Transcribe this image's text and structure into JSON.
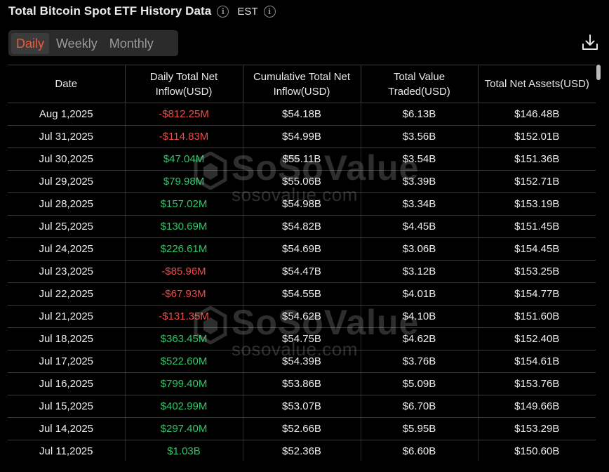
{
  "header": {
    "title": "Total Bitcoin Spot ETF History Data",
    "timezone": "EST",
    "info_icon": "info-icon"
  },
  "tabs": [
    {
      "label": "Daily",
      "active": true
    },
    {
      "label": "Weekly",
      "active": false
    },
    {
      "label": "Monthly",
      "active": false
    }
  ],
  "toolbar": {
    "download_icon": "download-icon"
  },
  "table": {
    "columns": [
      "Date",
      "Daily Total Net Inflow(USD)",
      "Cumulative Total Net Inflow(USD)",
      "Total Value Traded(USD)",
      "Total Net Assets(USD)"
    ],
    "rows": [
      {
        "date": "Aug 1,2025",
        "inflow": "-$812.25M",
        "sign": "neg",
        "cumulative": "$54.18B",
        "traded": "$6.13B",
        "assets": "$146.48B"
      },
      {
        "date": "Jul 31,2025",
        "inflow": "-$114.83M",
        "sign": "neg",
        "cumulative": "$54.99B",
        "traded": "$3.56B",
        "assets": "$152.01B"
      },
      {
        "date": "Jul 30,2025",
        "inflow": "$47.04M",
        "sign": "pos",
        "cumulative": "$55.11B",
        "traded": "$3.54B",
        "assets": "$151.36B"
      },
      {
        "date": "Jul 29,2025",
        "inflow": "$79.98M",
        "sign": "pos",
        "cumulative": "$55.06B",
        "traded": "$3.39B",
        "assets": "$152.71B"
      },
      {
        "date": "Jul 28,2025",
        "inflow": "$157.02M",
        "sign": "pos",
        "cumulative": "$54.98B",
        "traded": "$3.34B",
        "assets": "$153.19B"
      },
      {
        "date": "Jul 25,2025",
        "inflow": "$130.69M",
        "sign": "pos",
        "cumulative": "$54.82B",
        "traded": "$4.45B",
        "assets": "$151.45B"
      },
      {
        "date": "Jul 24,2025",
        "inflow": "$226.61M",
        "sign": "pos",
        "cumulative": "$54.69B",
        "traded": "$3.06B",
        "assets": "$154.45B"
      },
      {
        "date": "Jul 23,2025",
        "inflow": "-$85.96M",
        "sign": "neg",
        "cumulative": "$54.47B",
        "traded": "$3.12B",
        "assets": "$153.25B"
      },
      {
        "date": "Jul 22,2025",
        "inflow": "-$67.93M",
        "sign": "neg",
        "cumulative": "$54.55B",
        "traded": "$4.01B",
        "assets": "$154.77B"
      },
      {
        "date": "Jul 21,2025",
        "inflow": "-$131.35M",
        "sign": "neg",
        "cumulative": "$54.62B",
        "traded": "$4.10B",
        "assets": "$151.60B"
      },
      {
        "date": "Jul 18,2025",
        "inflow": "$363.45M",
        "sign": "pos",
        "cumulative": "$54.75B",
        "traded": "$4.62B",
        "assets": "$152.40B"
      },
      {
        "date": "Jul 17,2025",
        "inflow": "$522.60M",
        "sign": "pos",
        "cumulative": "$54.39B",
        "traded": "$3.76B",
        "assets": "$154.61B"
      },
      {
        "date": "Jul 16,2025",
        "inflow": "$799.40M",
        "sign": "pos",
        "cumulative": "$53.86B",
        "traded": "$5.09B",
        "assets": "$153.76B"
      },
      {
        "date": "Jul 15,2025",
        "inflow": "$402.99M",
        "sign": "pos",
        "cumulative": "$53.07B",
        "traded": "$6.70B",
        "assets": "$149.66B"
      },
      {
        "date": "Jul 14,2025",
        "inflow": "$297.40M",
        "sign": "pos",
        "cumulative": "$52.66B",
        "traded": "$5.95B",
        "assets": "$153.29B"
      },
      {
        "date": "Jul 11,2025",
        "inflow": "$1.03B",
        "sign": "pos",
        "cumulative": "$52.36B",
        "traded": "$6.60B",
        "assets": "$150.60B"
      }
    ]
  },
  "watermark": {
    "name": "SoSoValue",
    "url": "sosovalue.com"
  },
  "colors": {
    "background": "#000000",
    "accent": "#ef5a3c",
    "negative": "#f04a46",
    "positive": "#2fc565"
  }
}
